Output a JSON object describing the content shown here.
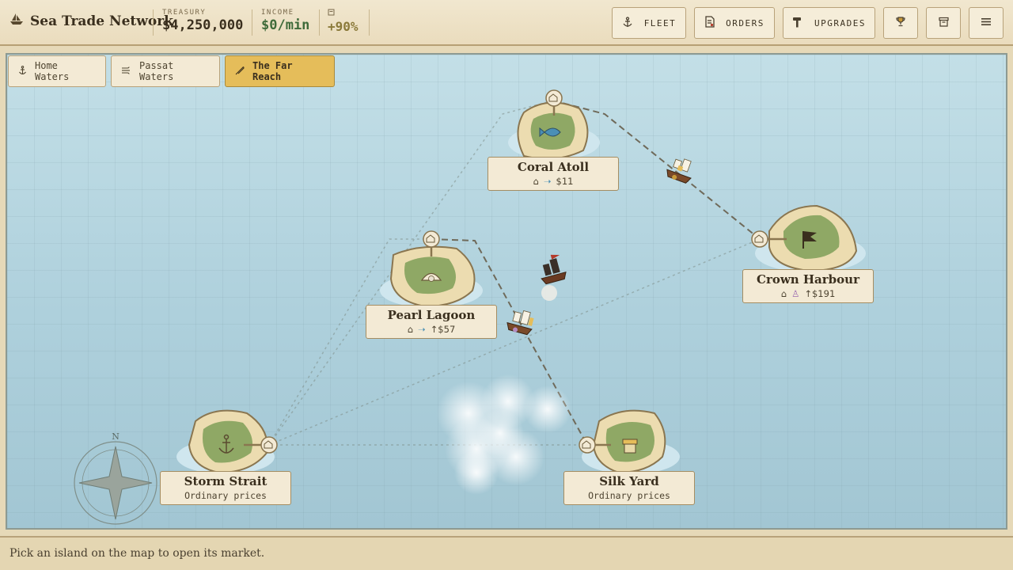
{
  "brand": {
    "title": "Sea Trade Network",
    "icon": "sailboat-icon"
  },
  "stats": [
    {
      "label": "TREASURY",
      "value": "$4,250,000",
      "color": "#3a2f1e"
    },
    {
      "label": "INCOME",
      "value": "$0/min",
      "color": "#3f6b3a"
    },
    {
      "label": "",
      "value": "+90%",
      "color": "#8b7a3a",
      "icon": "scroll-icon"
    }
  ],
  "toolbar": {
    "fleet_label": "FLEET",
    "orders_label": "ORDERS",
    "upgrades_label": "UPGRADES"
  },
  "regions": [
    {
      "label": "Home Waters",
      "icon": "anchor-icon",
      "active": false
    },
    {
      "label": "Passat Waters",
      "icon": "wind-icon",
      "active": false
    },
    {
      "label": "The Far Reach",
      "icon": "quill-icon",
      "active": true
    }
  ],
  "islands": [
    {
      "name": "Coral Atoll",
      "price": "$11",
      "goods_icon": "fish-icon"
    },
    {
      "name": "Crown Harbour",
      "price": "↑$191",
      "goods_icon": "potion-icon"
    },
    {
      "name": "Pearl Lagoon",
      "price": "↑$57",
      "goods_icon": "fish-icon"
    },
    {
      "name": "Storm Strait",
      "price": "Ordinary prices"
    },
    {
      "name": "Silk Yard",
      "price": "Ordinary prices"
    }
  ],
  "compass": {
    "north": "N"
  },
  "status": "Pick an island on the map to open its market.",
  "colors": {
    "accent": "#e5bd5a",
    "sea": "#b5d6e0",
    "sand": "#ecdcb0",
    "grass": "#8fa865"
  }
}
